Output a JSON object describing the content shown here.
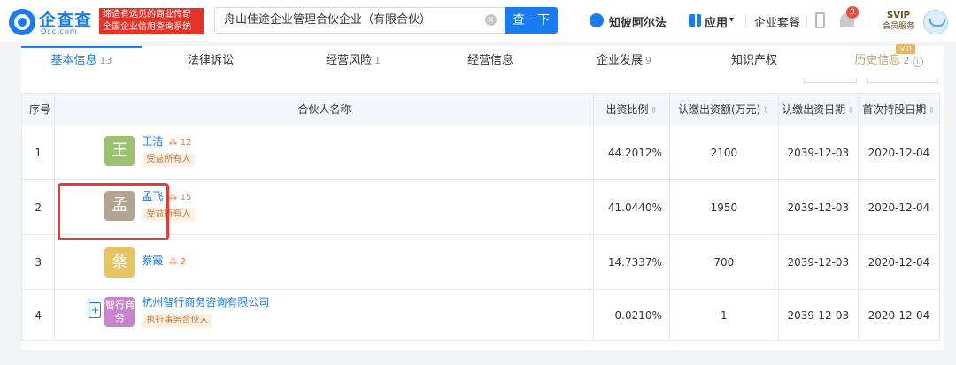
{
  "header": {
    "logo_text": "企查查",
    "logo_sub": "Qcc.com",
    "slogan": "缔造有远见的商业传奇 全国企业信用查询系统",
    "search_value": "舟山佳途企业管理合伙企业（有限合伙）",
    "search_button": "查一下",
    "zhiyu": "知彼阿尔法",
    "apps": "应用",
    "apps_caret": "▾",
    "package": "企业套餐",
    "notification_count": "3",
    "svip_title": "SVIP",
    "svip_sub": "会员服务"
  },
  "tabs": [
    {
      "label": "基本信息",
      "count": "13"
    },
    {
      "label": "法律诉讼",
      "count": ""
    },
    {
      "label": "经营风险",
      "count": "1"
    },
    {
      "label": "经营信息",
      "count": ""
    },
    {
      "label": "企业发展",
      "count": "9"
    },
    {
      "label": "知识产权",
      "count": ""
    },
    {
      "label": "历史信息",
      "count": "2"
    }
  ],
  "vip_tag": "VIP",
  "table": {
    "headers": [
      "序号",
      "合伙人名称",
      "出资比例",
      "认缴出资额(万元)",
      "认缴出资日期",
      "首次持股日期"
    ],
    "sort_glyph": "⇕",
    "rows": [
      {
        "index": "1",
        "avatar": "王",
        "avatar_color": "#9bc36f",
        "name": "王洁",
        "links": "12",
        "tag": "受益所有人",
        "ratio": "44.2012%",
        "amount": "2100",
        "date": "2039-12-03",
        "first": "2020-12-04"
      },
      {
        "index": "2",
        "avatar": "孟",
        "avatar_color": "#b3a38f",
        "name": "孟飞",
        "links": "15",
        "tag": "受益所有人",
        "ratio": "41.0440%",
        "amount": "1950",
        "date": "2039-12-03",
        "first": "2020-12-04"
      },
      {
        "index": "3",
        "avatar": "蔡",
        "avatar_color": "#e6c45f",
        "name": "蔡霞",
        "links": "2",
        "tag": "",
        "ratio": "14.7337%",
        "amount": "700",
        "date": "2039-12-03",
        "first": "2020-12-04"
      },
      {
        "index": "4",
        "avatar": "智行商务",
        "avatar_color": "#c883cd",
        "name": "杭州智行商务咨询有限公司",
        "links": "",
        "tag": "执行事务合伙人",
        "ratio": "0.0210%",
        "amount": "1",
        "date": "2039-12-03",
        "first": "2020-12-04"
      }
    ]
  }
}
